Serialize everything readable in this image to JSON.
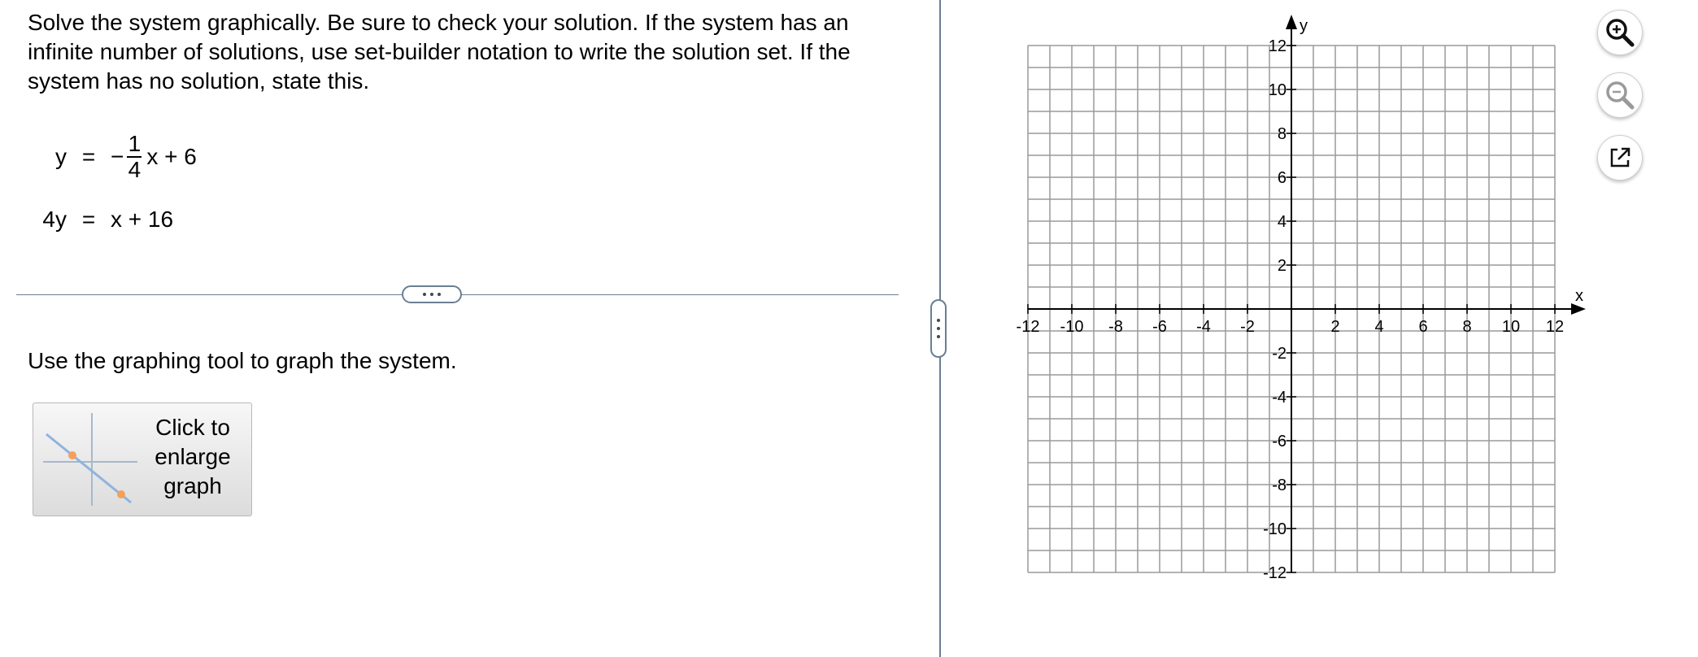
{
  "question": {
    "instructions": "Solve the system graphically. Be sure to check your solution. If the system has an infinite number of solutions, use set-builder notation to write the solution set. If the system has no solution, state this.",
    "equation1": {
      "lhs": "y",
      "sign": "=",
      "neg": "−",
      "numerator": "1",
      "denominator": "4",
      "rest": "x + 6"
    },
    "equation2": {
      "lhs": "4y",
      "sign": "=",
      "rhs": "x + 16"
    }
  },
  "tool_prompt": "Use the graphing tool to graph the system.",
  "enlarge_button": {
    "label": "Click to\nenlarge\ngraph"
  },
  "graph": {
    "x_axis_label": "x",
    "y_axis_label": "y",
    "x_ticks": [
      "-12",
      "-10",
      "-8",
      "-6",
      "-4",
      "-2",
      "2",
      "4",
      "6",
      "8",
      "10",
      "12"
    ],
    "y_ticks": [
      "12",
      "10",
      "8",
      "6",
      "4",
      "2",
      "-2",
      "-4",
      "-6",
      "-8",
      "-10",
      "-12"
    ],
    "xlim": [
      -12,
      12
    ],
    "ylim": [
      -12,
      12
    ],
    "grid": true
  },
  "tools": [
    {
      "name": "zoom-in-icon"
    },
    {
      "name": "zoom-out-icon"
    },
    {
      "name": "pop-out-icon"
    }
  ]
}
